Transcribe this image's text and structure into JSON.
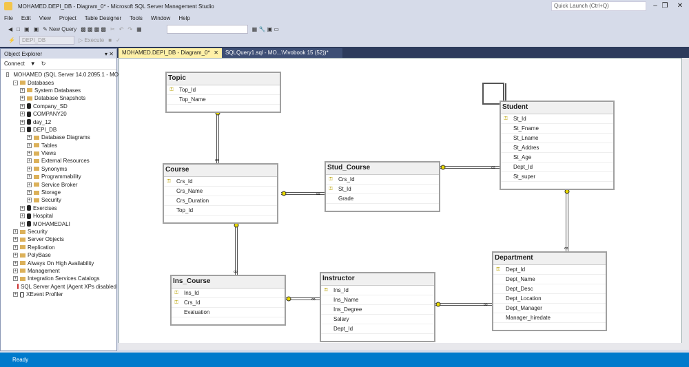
{
  "window": {
    "title": "MOHAMED.DEPI_DB - Diagram_0* - Microsoft SQL Server Management Studio",
    "quick_launch": "Quick Launch (Ctrl+Q)"
  },
  "menu": [
    "File",
    "Edit",
    "View",
    "Project",
    "Table Designer",
    "Tools",
    "Window",
    "Help"
  ],
  "toolbar": {
    "new_query": "New Query",
    "database": "DEPI_DB",
    "execute": "Execute"
  },
  "tabs": [
    {
      "label": "MOHAMED.DEPI_DB - Diagram_0*",
      "active": true
    },
    {
      "label": "SQLQuery1.sql - MO...\\Vivobook 15 (52))*",
      "active": false
    }
  ],
  "object_explorer": {
    "title": "Object Explorer",
    "connect": "Connect",
    "items": [
      {
        "label": "MOHAMED (SQL Server 14.0.2095.1 - MO",
        "level": 0,
        "icon": "server",
        "exp": "-"
      },
      {
        "label": "Databases",
        "level": 1,
        "icon": "folder",
        "exp": "-"
      },
      {
        "label": "System Databases",
        "level": 2,
        "icon": "folder",
        "exp": "+"
      },
      {
        "label": "Database Snapshots",
        "level": 2,
        "icon": "folder",
        "exp": "+"
      },
      {
        "label": "Company_SD",
        "level": 2,
        "icon": "db",
        "exp": "+"
      },
      {
        "label": "COMPANY20",
        "level": 2,
        "icon": "db",
        "exp": "+"
      },
      {
        "label": "day_12",
        "level": 2,
        "icon": "db",
        "exp": "+"
      },
      {
        "label": "DEPI_DB",
        "level": 2,
        "icon": "db",
        "exp": "-"
      },
      {
        "label": "Database Diagrams",
        "level": 3,
        "icon": "folder",
        "exp": "+"
      },
      {
        "label": "Tables",
        "level": 3,
        "icon": "folder",
        "exp": "+"
      },
      {
        "label": "Views",
        "level": 3,
        "icon": "folder",
        "exp": "+"
      },
      {
        "label": "External Resources",
        "level": 3,
        "icon": "folder",
        "exp": "+"
      },
      {
        "label": "Synonyms",
        "level": 3,
        "icon": "folder",
        "exp": "+"
      },
      {
        "label": "Programmability",
        "level": 3,
        "icon": "folder",
        "exp": "+"
      },
      {
        "label": "Service Broker",
        "level": 3,
        "icon": "folder",
        "exp": "+"
      },
      {
        "label": "Storage",
        "level": 3,
        "icon": "folder",
        "exp": "+"
      },
      {
        "label": "Security",
        "level": 3,
        "icon": "folder",
        "exp": "+"
      },
      {
        "label": "Exercises",
        "level": 2,
        "icon": "db",
        "exp": "+"
      },
      {
        "label": "Hospital",
        "level": 2,
        "icon": "db",
        "exp": "+"
      },
      {
        "label": "MOHAMEDALI",
        "level": 2,
        "icon": "db",
        "exp": "+"
      },
      {
        "label": "Security",
        "level": 1,
        "icon": "folder",
        "exp": "+"
      },
      {
        "label": "Server Objects",
        "level": 1,
        "icon": "folder",
        "exp": "+"
      },
      {
        "label": "Replication",
        "level": 1,
        "icon": "folder",
        "exp": "+"
      },
      {
        "label": "PolyBase",
        "level": 1,
        "icon": "folder",
        "exp": "+"
      },
      {
        "label": "Always On High Availability",
        "level": 1,
        "icon": "folder",
        "exp": "+"
      },
      {
        "label": "Management",
        "level": 1,
        "icon": "folder",
        "exp": "+"
      },
      {
        "label": "Integration Services Catalogs",
        "level": 1,
        "icon": "folder",
        "exp": "+"
      },
      {
        "label": "SQL Server Agent (Agent XPs disabled",
        "level": 1,
        "icon": "agent",
        "exp": ""
      },
      {
        "label": "XEvent Profiler",
        "level": 1,
        "icon": "xevent",
        "exp": "+"
      }
    ]
  },
  "tables": [
    {
      "name": "Topic",
      "columns": [
        {
          "n": "Top_Id",
          "pk": true
        },
        {
          "n": "Top_Name"
        }
      ]
    },
    {
      "name": "Course",
      "columns": [
        {
          "n": "Crs_Id",
          "pk": true
        },
        {
          "n": "Crs_Name"
        },
        {
          "n": "Crs_Duration"
        },
        {
          "n": "Top_Id"
        }
      ]
    },
    {
      "name": "Stud_Course",
      "columns": [
        {
          "n": "Crs_Id",
          "pk": true
        },
        {
          "n": "St_Id",
          "pk": true
        },
        {
          "n": "Grade"
        }
      ]
    },
    {
      "name": "Student",
      "columns": [
        {
          "n": "St_Id",
          "pk": true
        },
        {
          "n": "St_Fname"
        },
        {
          "n": "St_Lname"
        },
        {
          "n": "St_Addres"
        },
        {
          "n": "St_Age"
        },
        {
          "n": "Dept_Id"
        },
        {
          "n": "St_super"
        }
      ]
    },
    {
      "name": "Department",
      "columns": [
        {
          "n": "Dept_Id",
          "pk": true
        },
        {
          "n": "Dept_Name"
        },
        {
          "n": "Dept_Desc"
        },
        {
          "n": "Dept_Location"
        },
        {
          "n": "Dept_Manager"
        },
        {
          "n": "Manager_hiredate"
        }
      ]
    },
    {
      "name": "Instructor",
      "columns": [
        {
          "n": "Ins_Id",
          "pk": true
        },
        {
          "n": "Ins_Name"
        },
        {
          "n": "Ins_Degree"
        },
        {
          "n": "Salary"
        },
        {
          "n": "Dept_Id"
        }
      ]
    },
    {
      "name": "Ins_Course",
      "columns": [
        {
          "n": "Ins_Id",
          "pk": true
        },
        {
          "n": "Crs_Id",
          "pk": true
        },
        {
          "n": "Evaluation"
        }
      ]
    }
  ],
  "status": "Ready",
  "colors": {
    "statusbar": "#007acc",
    "active_tab": "#fff1a8",
    "key": "#e8d800"
  }
}
